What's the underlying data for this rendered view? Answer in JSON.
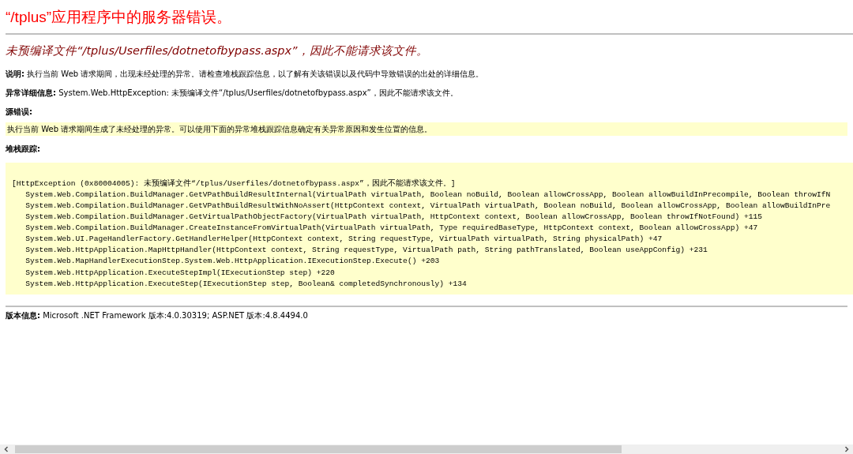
{
  "title": "“/tplus”应用程序中的服务器错误。",
  "subtitle": "未预编译文件“/tplus/Userfiles/dotnetofbypass.aspx”，因此不能请求该文件。",
  "description": "**说明:** 执行当前 Web 请求期间，出现未经处理的异常。请检查堆栈跟踪信息，以了解有关该错误以及代码中导致错误的出处的详细信息。",
  "exception_details": "**异常详细信息:** System.Web.HttpException: 未预编译文件“/tplus/Userfiles/dotnetofbypass.aspx”，因此不能请求该文件。",
  "source_error_heading": "源错误:",
  "source_error": "执行当前 Web 请求期间生成了未经处理的异常。可以使用下面的异常堆栈跟踪信息确定有关异常原因和发生位置的信息。",
  "stack_trace_heading": "堆栈跟踪:",
  "stack_trace": [
    "[HttpException (0x80004005): 未预编译文件“/tplus/Userfiles/dotnetofbypass.aspx”，因此不能请求该文件。]",
    "   System.Web.Compilation.BuildManager.GetVPathBuildResultInternal(VirtualPath virtualPath, Boolean noBuild, Boolean allowCrossApp, Boolean allowBuildInPrecompile, Boolean throwIfN",
    "   System.Web.Compilation.BuildManager.GetVPathBuildResultWithNoAssert(HttpContext context, VirtualPath virtualPath, Boolean noBuild, Boolean allowCrossApp, Boolean allowBuildInPre",
    "   System.Web.Compilation.BuildManager.GetVirtualPathObjectFactory(VirtualPath virtualPath, HttpContext context, Boolean allowCrossApp, Boolean throwIfNotFound) +115",
    "   System.Web.Compilation.BuildManager.CreateInstanceFromVirtualPath(VirtualPath virtualPath, Type requiredBaseType, HttpContext context, Boolean allowCrossApp) +47",
    "   System.Web.UI.PageHandlerFactory.GetHandlerHelper(HttpContext context, String requestType, VirtualPath virtualPath, String physicalPath) +47",
    "   System.Web.HttpApplication.MapHttpHandler(HttpContext context, String requestType, VirtualPath path, String pathTranslated, Boolean useAppConfig) +231",
    "   System.Web.MapHandlerExecutionStep.System.Web.HttpApplication.IExecutionStep.Execute() +203",
    "   System.Web.HttpApplication.ExecuteStepImpl(IExecutionStep step) +220",
    "   System.Web.HttpApplication.ExecuteStep(IExecutionStep step, Boolean& completedSynchronously) +134"
  ],
  "version_info": "**版本信息:** Microsoft .NET Framework 版本:4.0.30319; ASP.NET 版本:4.8.4494.0"
}
